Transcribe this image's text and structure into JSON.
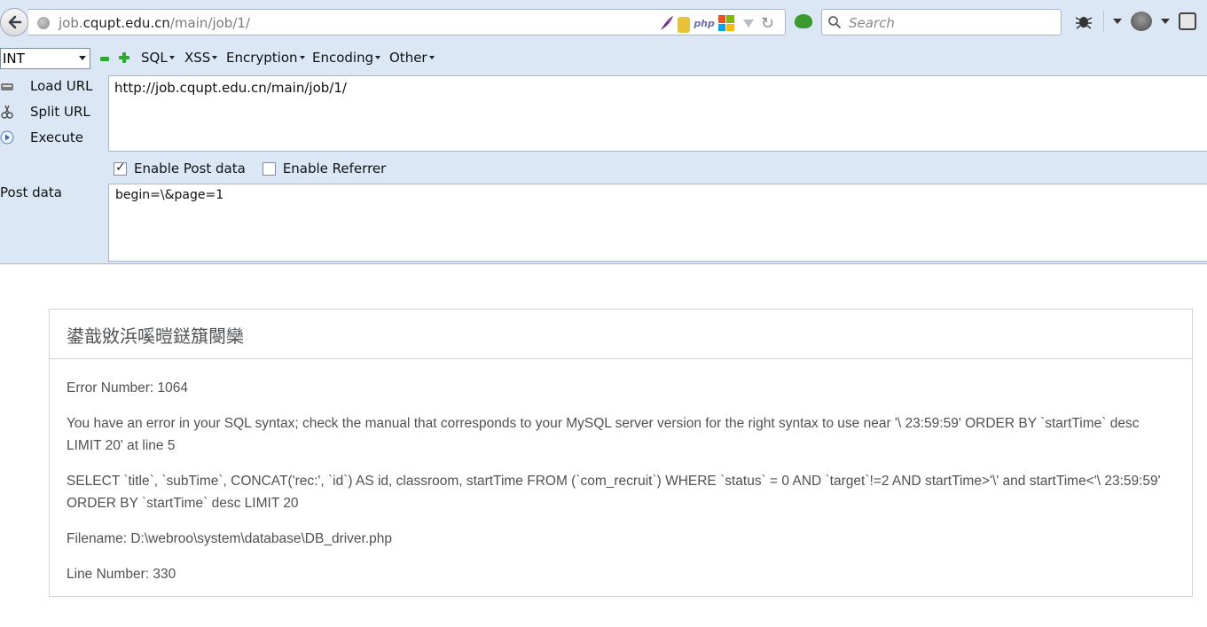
{
  "browser": {
    "url_prefix": "job.",
    "url_domain": "cqupt.edu.cn",
    "url_path": "/main/job/1/",
    "php_badge": "php",
    "search_placeholder": "Search"
  },
  "hackbar": {
    "select_value": "INT",
    "menus": [
      "SQL",
      "XSS",
      "Encryption",
      "Encoding",
      "Other"
    ],
    "load_url": "Load URL",
    "split_url": "Split URL",
    "execute": "Execute",
    "url_value": "http://job.cqupt.edu.cn/main/job/1/",
    "enable_post": "Enable Post data",
    "enable_post_checked": true,
    "enable_referrer": "Enable Referrer",
    "enable_referrer_checked": false,
    "post_label": "Post data",
    "post_value": "begin=\\&page=1"
  },
  "error": {
    "title": "鍙戠敓浜嗘暟鎹簱閿欒",
    "number": "Error Number: 1064",
    "message": "You have an error in your SQL syntax; check the manual that corresponds to your MySQL server version for the right syntax to use near '\\ 23:59:59' ORDER BY `startTime` desc LIMIT 20' at line 5",
    "query": "SELECT `title`, `subTime`, CONCAT('rec:', `id`) AS id, classroom, startTime FROM (`com_recruit`) WHERE `status` = 0 AND `target`!=2 AND startTime>'\\' and startTime<'\\ 23:59:59' ORDER BY `startTime` desc LIMIT 20",
    "filename": "Filename: D:\\webroo\\system\\database\\DB_driver.php",
    "line": "Line Number: 330"
  }
}
